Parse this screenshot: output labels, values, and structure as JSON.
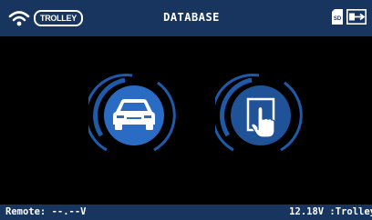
{
  "header": {
    "trolley_badge": "TROLLEY",
    "title": "DATABASE",
    "sd_label": "SD"
  },
  "main": {
    "buttons": [
      {
        "name": "vehicle-database-button",
        "icon": "car-icon"
      },
      {
        "name": "manual-selection-button",
        "icon": "hand-touch-icon"
      }
    ]
  },
  "footer": {
    "remote_status": "Remote: --.--V",
    "trolley_status": "12.18V :Trolley"
  },
  "colors": {
    "header_bg": "#17355e",
    "accent_blue": "#1e5aa8",
    "ring_blue": "#2a6cc4",
    "screen_bg": "#000000"
  }
}
